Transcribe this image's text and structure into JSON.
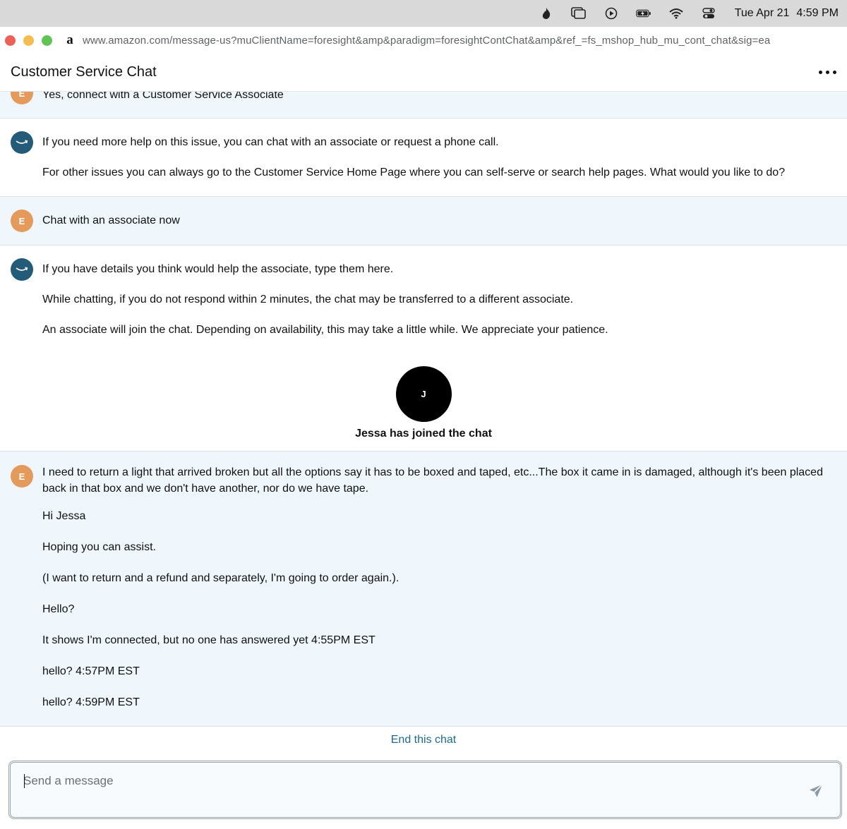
{
  "menubar": {
    "icons": [
      "flame-icon",
      "window-stack-icon",
      "play-circle-icon",
      "battery-charging-icon",
      "wifi-icon",
      "control-center-icon"
    ],
    "date": "Tue Apr 21",
    "time": "4:59 PM"
  },
  "browser": {
    "favicon": "a",
    "url": "www.amazon.com/message-us?muClientName=foresight&amp&paradigm=foresightContChat&amp&ref_=fs_mshop_hub_mu_cont_chat&sig=ea"
  },
  "header": {
    "title": "Customer Service Chat"
  },
  "messages": [
    {
      "sender": "user",
      "avatar": "E",
      "lines": [
        "Yes, connect with a Customer Service Associate"
      ]
    },
    {
      "sender": "bot",
      "lines": [
        "If you need more help on this issue, you can chat with an associate or request a phone call.",
        "For other issues you can always go to the Customer Service Home Page where you can self-serve or search help pages. What would you like to do?"
      ]
    },
    {
      "sender": "user",
      "avatar": "E",
      "lines": [
        "Chat with an associate now"
      ]
    },
    {
      "sender": "bot",
      "lines": [
        "If you have details you think would help the associate, type them here.",
        "While chatting, if you do not respond within 2 minutes, the chat may be transferred to a different associate.",
        "An associate will join the chat. Depending on availability, this may take a little while. We appreciate your patience."
      ]
    },
    {
      "sender": "user",
      "avatar": "E",
      "lines": [
        "I need to return a light that arrived broken but all the options say it has to be boxed and taped, etc...The box it came in is damaged, although it's been placed back in that box and we don't have another, nor do we have tape.",
        "Hi Jessa",
        "Hoping you can assist.",
        "(I want to return and a refund and separately, I'm going to order again.).",
        "Hello?",
        "It shows I'm connected, but no one has answered yet 4:55PM EST",
        "hello? 4:57PM EST",
        "hello? 4:59PM EST"
      ]
    }
  ],
  "agent_joined": {
    "initial": "J",
    "text": "Jessa has joined the chat"
  },
  "footer": {
    "end_chat": "End this chat",
    "input_placeholder": "Send a message",
    "input_value": ""
  },
  "colors": {
    "user_bg": "#f0f7fc",
    "user_avatar": "#e49a5b",
    "bot_avatar": "#245b79",
    "link": "#1e6b8a"
  }
}
